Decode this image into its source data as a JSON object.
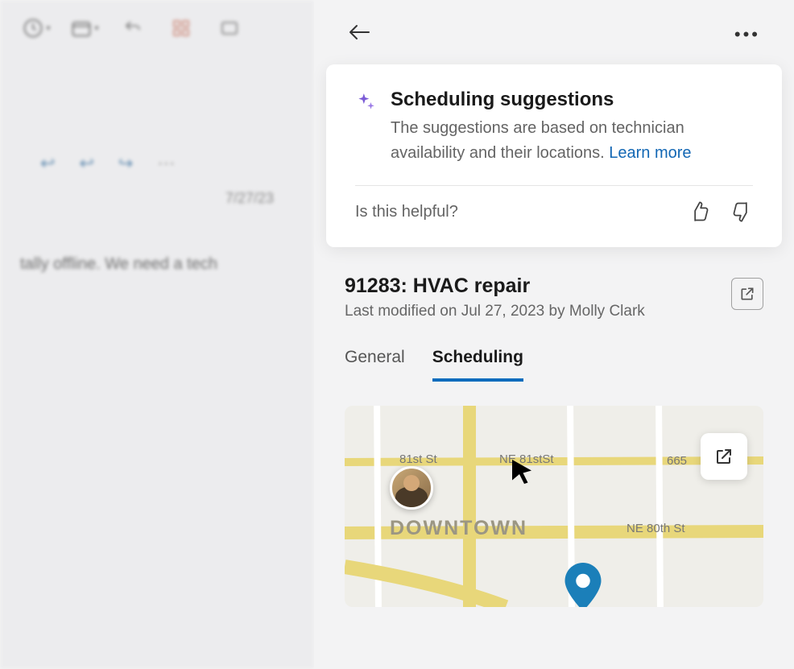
{
  "left_pane": {
    "email_date": "7/27/23",
    "email_snippet": "tally offline. We need a tech"
  },
  "pane_header": {
    "back_label": "Back",
    "more_label": "More options"
  },
  "suggestion_card": {
    "icon": "sparkle-icon",
    "title": "Scheduling suggestions",
    "description": "The suggestions are based on technician availability and their locations. ",
    "learn_more": "Learn more",
    "feedback_prompt": "Is this helpful?"
  },
  "work_order": {
    "title": "91283: HVAC repair",
    "last_modified": "Last modified on Jul 27, 2023 by Molly Clark",
    "open_label": "Open record"
  },
  "tabs": {
    "general": "General",
    "scheduling": "Scheduling",
    "active": "scheduling"
  },
  "map": {
    "labels": {
      "street_81": "81st St",
      "ne_81": "NE 81stSt",
      "number_665": "665",
      "ne_80": "NE 80th St",
      "downtown": "DOWNTOWN"
    },
    "open_label": "Open map"
  }
}
